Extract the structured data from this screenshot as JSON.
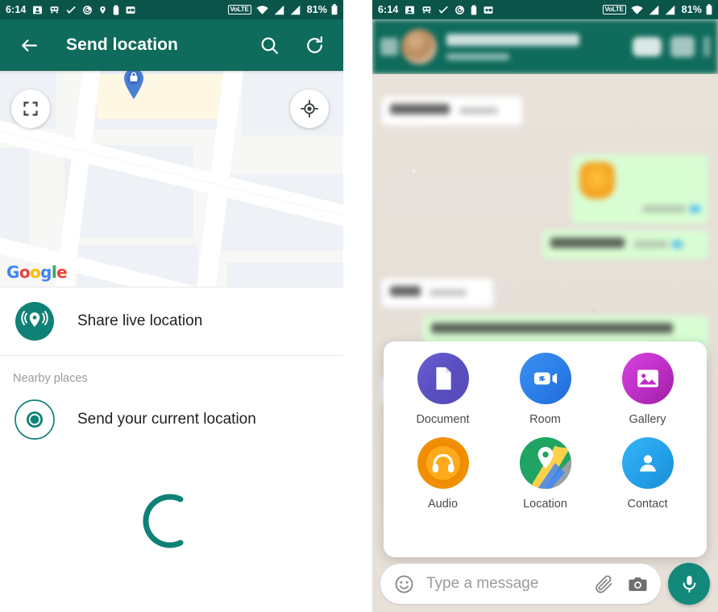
{
  "statusbar": {
    "time": "6:14",
    "battery_percent": "81%",
    "network_label": "VoLTE",
    "icons": [
      "contact-icon",
      "transit-icon",
      "check-icon",
      "screen-record-icon",
      "location-icon",
      "battery-saver-icon",
      "picture-in-picture-icon",
      "wifi-icon",
      "signal-icon",
      "signal-icon-2",
      "battery-icon"
    ]
  },
  "left": {
    "appbar": {
      "title": "Send location",
      "back_icon": "back-arrow-icon",
      "search_icon": "search-icon",
      "refresh_icon": "refresh-icon"
    },
    "map": {
      "attribution": "Google",
      "attribution_letters": [
        "G",
        "o",
        "o",
        "g",
        "l",
        "e"
      ],
      "fullscreen_icon": "fullscreen-icon",
      "my_location_icon": "my-location-icon",
      "pin_icon": "map-pin-icon"
    },
    "options": [
      {
        "label": "Share live location",
        "icon": "live-location-icon"
      }
    ],
    "section_label": "Nearby places",
    "nearby": [
      {
        "label": "Send your current location",
        "icon": "current-location-icon"
      }
    ],
    "loading": {
      "icon": "loading-spinner-icon",
      "state": "loading"
    }
  },
  "right": {
    "chat_header": {
      "back_icon": "back-arrow-icon",
      "avatar": "contact-avatar",
      "contact_name": "",
      "contact_status": "",
      "video_call_icon": "video-call-icon",
      "voice_call_icon": "phone-call-icon",
      "overflow_icon": "more-options-icon"
    },
    "attachment_panel": {
      "items": [
        {
          "label": "Document",
          "icon": "document-icon",
          "color": "#5f56c4"
        },
        {
          "label": "Room",
          "icon": "room-video-link-icon",
          "color": "#2a7ee8"
        },
        {
          "label": "Gallery",
          "icon": "gallery-photo-icon",
          "color": "#c030c8"
        },
        {
          "label": "Audio",
          "icon": "audio-headphones-icon",
          "color": "#f4a000"
        },
        {
          "label": "Location",
          "icon": "location-map-icon",
          "color": "#1fa463"
        },
        {
          "label": "Contact",
          "icon": "contact-person-icon",
          "color": "#23a0ea"
        }
      ]
    },
    "input_bar": {
      "placeholder": "Type a message",
      "value": "",
      "emoji_icon": "emoji-icon",
      "attach_icon": "paperclip-icon",
      "camera_icon": "camera-icon",
      "mic_icon": "microphone-icon"
    }
  },
  "colors": {
    "statusbar": "#0b544a",
    "appbar": "#0f6b5b",
    "accent_teal": "#0f8176",
    "mic_button": "#12897b",
    "chat_background": "#e5ded7",
    "outgoing_bubble": "#d9fdd3",
    "incoming_bubble": "#ffffff"
  }
}
